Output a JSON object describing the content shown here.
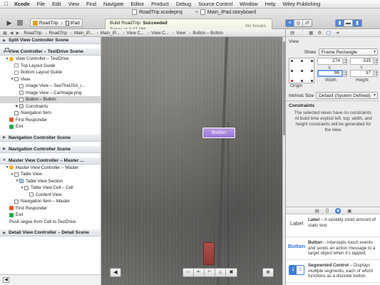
{
  "menubar": {
    "items": [
      "Xcode",
      "File",
      "Edit",
      "View",
      "Find",
      "Navigate",
      "Editor",
      "Product",
      "Debug",
      "Source Control",
      "Window",
      "Help",
      "Wiley Publishing"
    ]
  },
  "window": {
    "tabs": [
      "RoadTrip.xcodeproj",
      "Main_iPad.storyboard"
    ]
  },
  "toolbar": {
    "scheme": "RoadTrip",
    "device": "iPad",
    "status_prefix": "Build RoadTrip: ",
    "status_result": "Succeeded",
    "status_time": "Today at 3:37 PM",
    "issues": "No Issues"
  },
  "jumpbar": {
    "items": [
      "RoadTrip",
      "RoadTrip",
      "Main_iP...",
      "Main_iP...",
      "View C...",
      "View C...",
      "View",
      "Button – Button"
    ]
  },
  "outline": {
    "scenes": [
      {
        "title": "Split View Controller Scene",
        "rows": []
      },
      {
        "title": "View Controller – TestDrive Scene",
        "rows": [
          {
            "label": "View Controller – TestDrive",
            "icon": "vc",
            "indent": 1,
            "disc": "down"
          },
          {
            "label": "Top Layout Guide",
            "icon": "guide",
            "indent": 2,
            "disc": ""
          },
          {
            "label": "Bottom Layout Guide",
            "icon": "guide",
            "indent": 2,
            "disc": ""
          },
          {
            "label": "View",
            "icon": "view",
            "indent": 2,
            "disc": "down"
          },
          {
            "label": "Image View – SeeTheUSA_i...",
            "icon": "img",
            "indent": 3,
            "disc": ""
          },
          {
            "label": "Image View – CarImage.png",
            "icon": "img",
            "indent": 3,
            "disc": ""
          },
          {
            "label": "Button – Button",
            "icon": "btn",
            "indent": 3,
            "disc": "",
            "selected": true
          },
          {
            "label": "Constraints",
            "icon": "con",
            "indent": 3,
            "disc": "right"
          },
          {
            "label": "Navigation Item",
            "icon": "nav",
            "indent": 2,
            "disc": ""
          },
          {
            "label": "First Responder",
            "icon": "fr",
            "indent": 1,
            "disc": ""
          },
          {
            "label": "Exit",
            "icon": "exit",
            "indent": 1,
            "disc": ""
          }
        ]
      },
      {
        "title": "Navigation Controller Scene",
        "rows": []
      },
      {
        "title": "Navigation Controller Scene",
        "rows": []
      },
      {
        "title": "Master View Controller – Master ...",
        "rows": [
          {
            "label": "Master View Controller – Master",
            "icon": "vc",
            "indent": 1,
            "disc": "down"
          },
          {
            "label": "Table View",
            "icon": "tv",
            "indent": 2,
            "disc": "down"
          },
          {
            "label": "Table View Section",
            "icon": "tvs",
            "indent": 3,
            "disc": "down"
          },
          {
            "label": "Table View Cell – Cell",
            "icon": "cell",
            "indent": 4,
            "disc": "down"
          },
          {
            "label": "Content View",
            "icon": "view",
            "indent": 5,
            "disc": ""
          },
          {
            "label": "Navigation Item – Master",
            "icon": "nav",
            "indent": 2,
            "disc": ""
          },
          {
            "label": "First Responder",
            "icon": "fr",
            "indent": 1,
            "disc": ""
          },
          {
            "label": "Exit",
            "icon": "exit",
            "indent": 1,
            "disc": ""
          },
          {
            "label": "Push segue from Cell to TestDrive",
            "icon": "seg",
            "indent": 1,
            "disc": ""
          }
        ]
      },
      {
        "title": "Detail View Controller – Detail Scene",
        "rows": []
      }
    ]
  },
  "canvas": {
    "button_label": "Button"
  },
  "inspector": {
    "section": "View",
    "show_label": "Show",
    "show_value": "Frame Rectangle",
    "x": "274",
    "y": "335",
    "width": "96",
    "height": "37",
    "x_label": "X",
    "y_label": "Y",
    "width_label": "Width",
    "height_label": "Height",
    "origin_label": "Origin",
    "intrinsic_label": "Intrinsic Size",
    "intrinsic_value": "Default (System Defined)",
    "constraints_title": "Constraints",
    "constraints_desc": "The selected views have no constraints. At build time explicit left, top, width, and height constraints will be generated for the view."
  },
  "library": {
    "items": [
      {
        "thumb": "Label",
        "name": "Label",
        "desc": " – A variably sized amount of static text."
      },
      {
        "thumb": "Button",
        "name": "Button",
        "desc": " – Intercepts touch events and sends an action message to a target object when it's tapped."
      },
      {
        "thumb": "12",
        "name": "Segmented Control",
        "desc": " – Displays multiple segments, each of which functions as a discrete button."
      }
    ]
  }
}
